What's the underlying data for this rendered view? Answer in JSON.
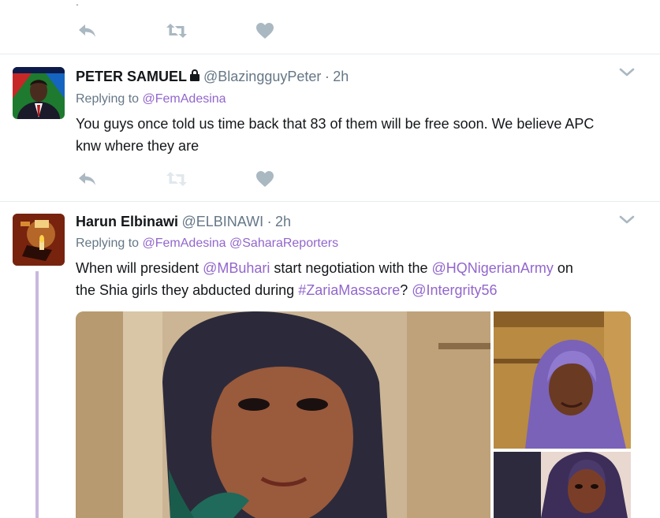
{
  "top_tweet": {
    "stray_mark": "."
  },
  "tweet1": {
    "name": "PETER SAMUEL",
    "lock_icon": "lock-icon",
    "handle": "@BlazingguyPeter",
    "separator": "·",
    "time": "2h",
    "replying_prefix": "Replying to",
    "replying_to": "@FemAdesina",
    "text": "You guys once told us time back that 83 of them will be free soon. We believe APC knw where they are"
  },
  "tweet2": {
    "name": "Harun Elbinawi",
    "handle": "@ELBINAWI",
    "separator": "·",
    "time": "2h",
    "replying_prefix": "Replying to",
    "replying_to_1": "@FemAdesina",
    "replying_to_2": "@SaharaReporters",
    "text_1": "When will president ",
    "mention_1": "@MBuhari",
    "text_2": " start negotiation with the ",
    "mention_2": "@HQNigerianArmy",
    "text_3": " on",
    "text_4": "the Shia girls they abducted during ",
    "hashtag": "#ZariaMassacre",
    "text_5": "? ",
    "mention_3": "@Intergrity56"
  },
  "icons": {
    "reply": "reply-icon",
    "retweet": "retweet-icon",
    "like": "heart-icon",
    "more": "chevron-down-icon"
  },
  "colors": {
    "link": "#9266cc",
    "secondary_text": "#657786",
    "icon": "#aab8c2",
    "divider": "#e6ecf0",
    "thread_line": "#c8b8dd"
  }
}
